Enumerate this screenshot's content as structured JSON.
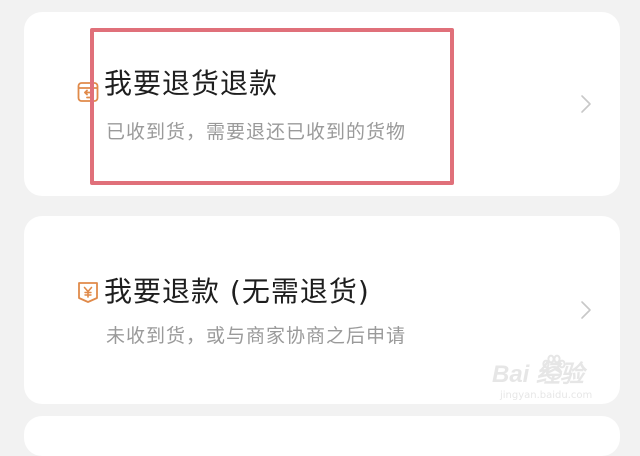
{
  "options": [
    {
      "title": "我要退货退款",
      "subtitle": "已收到货，需要退还已收到的货物",
      "icon": "return-box-icon",
      "highlighted": true
    },
    {
      "title": "我要退款 (无需退货)",
      "subtitle": "未收到货，或与商家协商之后申请",
      "icon": "refund-yen-icon",
      "highlighted": false
    }
  ],
  "colors": {
    "background": "#f2f2f2",
    "card": "#ffffff",
    "title_text": "#1e1e1e",
    "subtitle_text": "#9a9a9a",
    "icon_accent": "#e08a4a",
    "highlight_box": "#e0707a"
  },
  "watermark": {
    "brand": "Bai  经验",
    "url": "jingyan.baidu.com"
  }
}
